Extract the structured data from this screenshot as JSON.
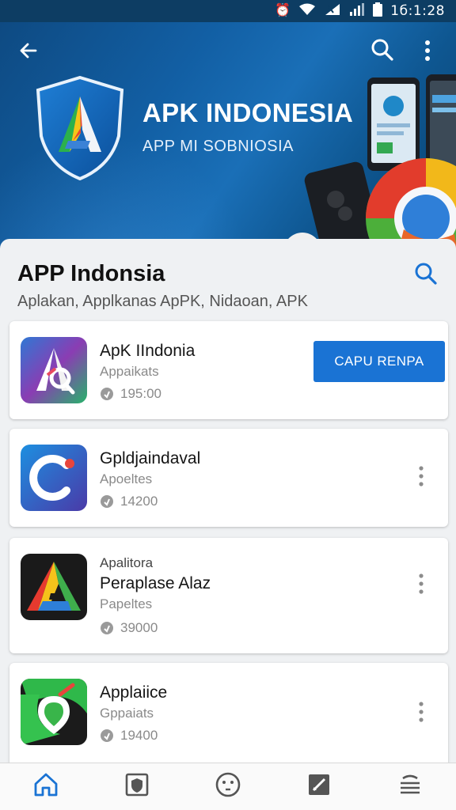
{
  "status_bar": {
    "time": "1б:1:28",
    "icons": [
      "alarm-icon",
      "wifi-icon",
      "signal-icon",
      "cell-signal-icon",
      "battery-icon"
    ]
  },
  "hero": {
    "title": "APK INDONESIA",
    "subtitle": "APP MI SOBNIOSIA",
    "icons": [
      "back-arrow-icon",
      "search-icon",
      "more-vert-icon"
    ]
  },
  "section": {
    "title": "APP Indonsia",
    "subtitle": "Aplakan, Applkanas ApPK, Nidaoan, APK"
  },
  "apps": [
    {
      "name": "ApK IIndonia",
      "category": "Appaikats",
      "count": "195:00",
      "action": "CAPU RENPA"
    },
    {
      "name": "Gpldjaindaval",
      "category": "Apoeltes",
      "count": "14200"
    },
    {
      "top_label": "Apalitora",
      "name": "Peraplase Alaz",
      "category": "Papeltes",
      "count": "39000"
    },
    {
      "name": "Applaiice",
      "category": "Gppaiats",
      "count": "19400"
    }
  ],
  "bottom_nav": [
    "home-icon",
    "shield-icon",
    "face-icon",
    "edit-icon",
    "menu-icon"
  ],
  "colors": {
    "primary": "#1a73d4",
    "banner": "#125fa4",
    "active_nav": "#1a73d4"
  }
}
